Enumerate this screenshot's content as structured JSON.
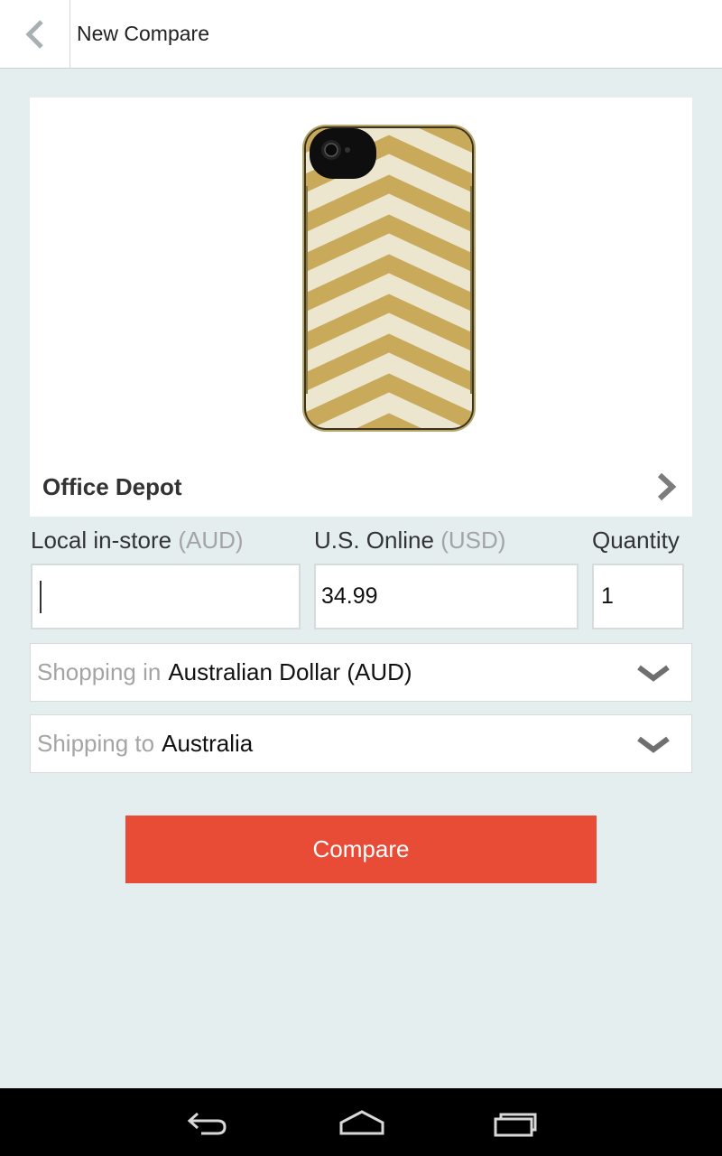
{
  "header": {
    "title": "New Compare",
    "back_icon": "chevron-left-icon"
  },
  "product": {
    "store": "Office Depot",
    "image_alt": "gold-chevron-phone-case-image"
  },
  "fields": {
    "local_label": "Local in-store",
    "local_unit": "(AUD)",
    "local_value": "",
    "us_label": "U.S. Online",
    "us_unit": "(USD)",
    "us_value": "34.99",
    "quantity_label": "Quantity",
    "quantity_value": "1"
  },
  "selects": {
    "currency_prefix": "Shopping in",
    "currency_value": "Australian Dollar (AUD)",
    "shipping_prefix": "Shipping to",
    "shipping_value": "Australia"
  },
  "actions": {
    "compare_label": "Compare"
  },
  "colors": {
    "background": "#e4eeef",
    "accent": "#e84c37",
    "muted_text": "#a4a4a4",
    "case_gold": "#c9a95a",
    "case_cream": "#ece6cf"
  }
}
